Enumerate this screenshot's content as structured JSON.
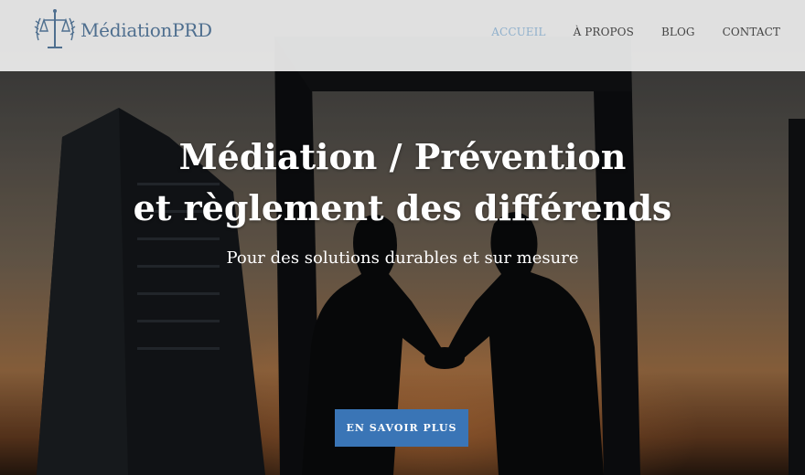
{
  "brand": {
    "name": "MédiationPRD",
    "logo_icon": "scales-of-justice-icon"
  },
  "nav": {
    "items": [
      {
        "label": "ACCUEIL",
        "active": true
      },
      {
        "label": "À PROPOS",
        "active": false
      },
      {
        "label": "BLOG",
        "active": false
      },
      {
        "label": "CONTACT",
        "active": false
      }
    ]
  },
  "hero": {
    "title_line1": "Médiation / Prévention",
    "title_line2": "et règlement des différends",
    "subtitle": "Pour des solutions durables et sur mesure",
    "cta_label": "EN SAVOIR PLUS"
  },
  "colors": {
    "accent": "#3a75b6",
    "nav_active": "#8fb0cc",
    "brand": "#4f6f8f"
  }
}
